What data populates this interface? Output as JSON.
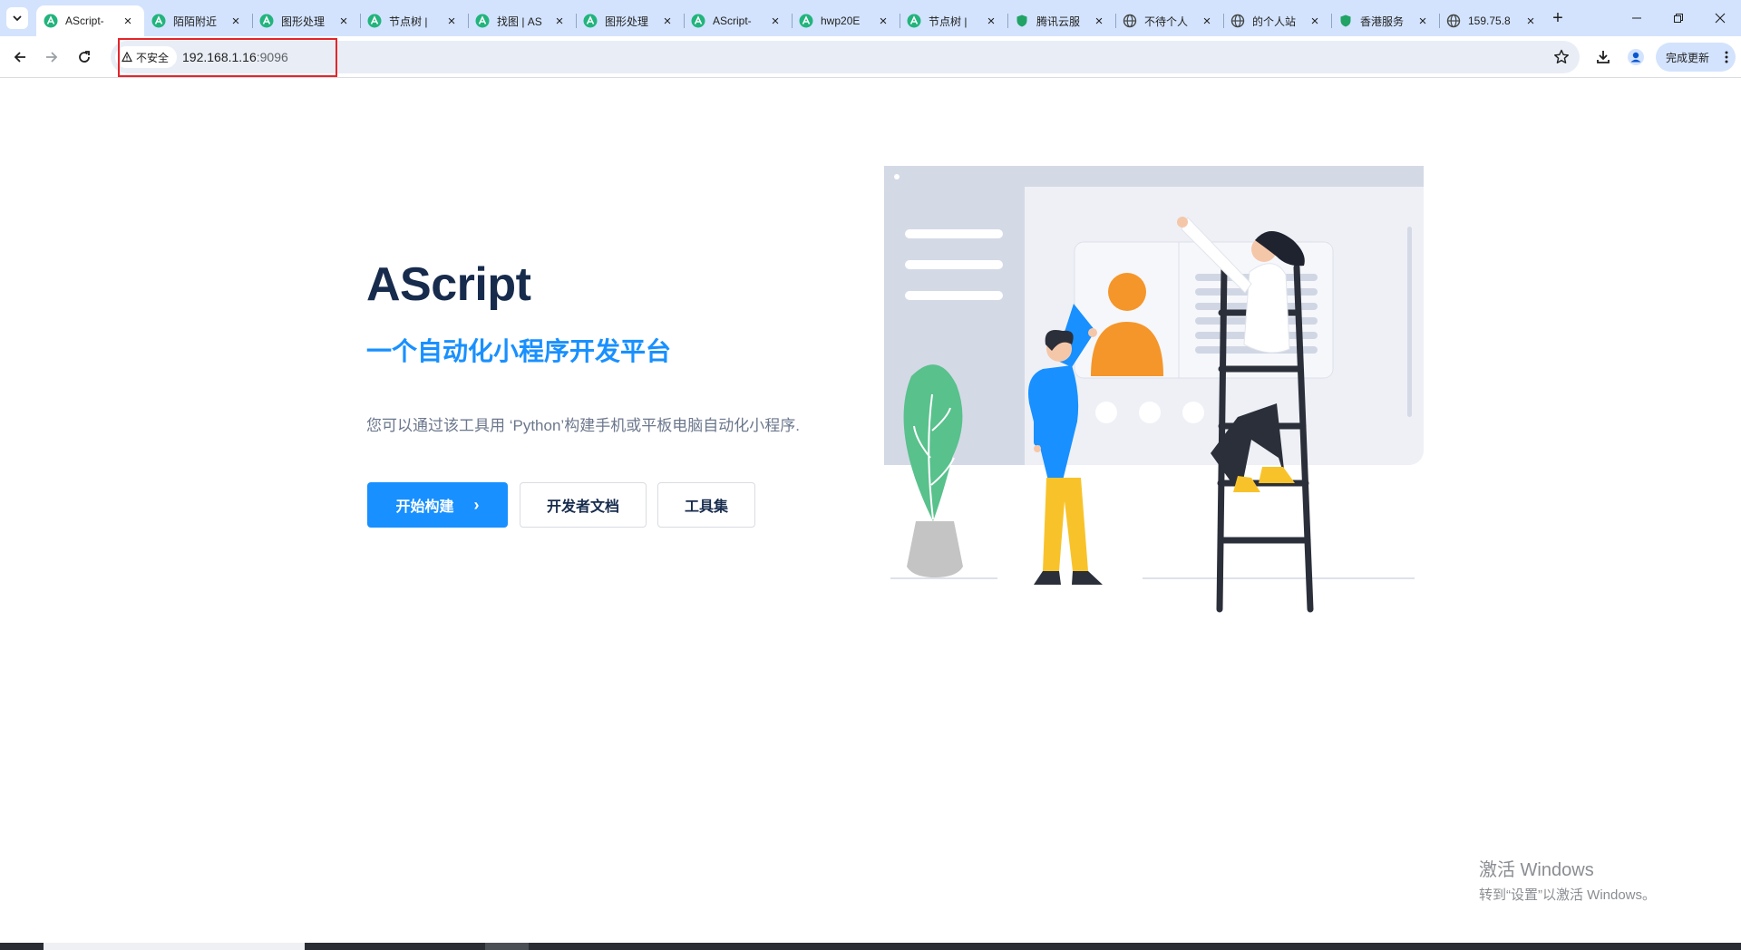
{
  "browser": {
    "tabs": [
      {
        "title": "AScript-",
        "favicon": "ascript-icon",
        "active": true
      },
      {
        "title": "陌陌附近",
        "favicon": "ascript-icon"
      },
      {
        "title": "图形处理",
        "favicon": "ascript-icon"
      },
      {
        "title": "节点树 |",
        "favicon": "ascript-icon"
      },
      {
        "title": "找图 | AS",
        "favicon": "ascript-icon"
      },
      {
        "title": "图形处理",
        "favicon": "ascript-icon"
      },
      {
        "title": "AScript-",
        "favicon": "ascript-icon"
      },
      {
        "title": "hwp20E",
        "favicon": "ascript-icon"
      },
      {
        "title": "节点树 |",
        "favicon": "ascript-icon"
      },
      {
        "title": "腾讯云服",
        "favicon": "shield-icon"
      },
      {
        "title": "不待个人",
        "favicon": "globe-icon"
      },
      {
        "title": "的个人站",
        "favicon": "globe-icon"
      },
      {
        "title": "香港服务",
        "favicon": "shield-icon"
      },
      {
        "title": "159.75.8",
        "favicon": "globe-icon"
      }
    ],
    "new_tab_label": "+",
    "security_label": "不安全",
    "url_host": "192.168.1.16",
    "url_port": ":9096",
    "update_label": "完成更新",
    "colors": {
      "accent": "#1890ff",
      "tabstrip": "#d3e3fd",
      "highlight": "#e5252a"
    }
  },
  "hero": {
    "title": "AScript",
    "subtitle": "一个自动化小程序开发平台",
    "description": "您可以通过该工具用 ‘Python’构建手机或平板电脑自动化小程序.",
    "buttons": {
      "primary": "开始构建",
      "primary_arrow": "›",
      "docs": "开发者文档",
      "tools": "工具集"
    }
  },
  "watermark": {
    "line1": "激活 Windows",
    "line2": "转到“设置”以激活 Windows。"
  }
}
